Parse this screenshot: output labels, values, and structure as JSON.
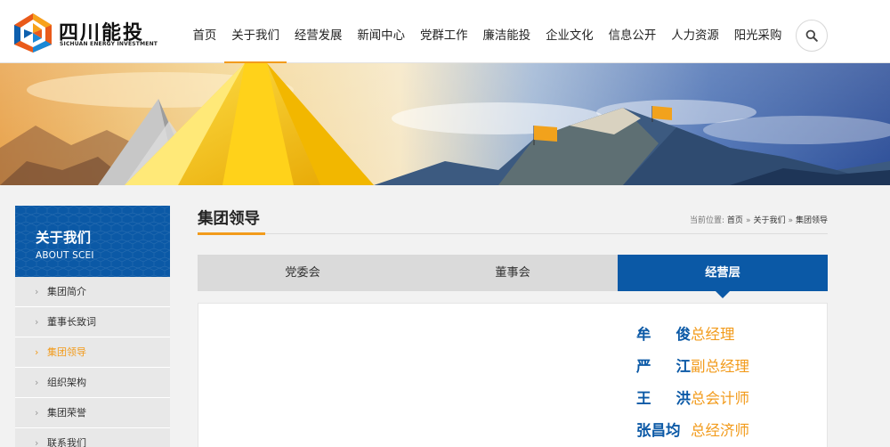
{
  "brand": {
    "name_cn": "四川能投",
    "name_en": "SICHUAN ENERGY INVESTMENT",
    "colors": {
      "blue": "#0b59a6",
      "orange": "#f29b1c"
    }
  },
  "nav": {
    "items": [
      {
        "label": "首页"
      },
      {
        "label": "关于我们",
        "active": true
      },
      {
        "label": "经营发展"
      },
      {
        "label": "新闻中心"
      },
      {
        "label": "党群工作"
      },
      {
        "label": "廉洁能投"
      },
      {
        "label": "企业文化"
      },
      {
        "label": "信息公开"
      },
      {
        "label": "人力资源"
      },
      {
        "label": "阳光采购"
      }
    ],
    "search_icon": "search-icon"
  },
  "sidebar": {
    "title": "关于我们",
    "subtitle": "ABOUT SCEI",
    "items": [
      {
        "label": "集团简介"
      },
      {
        "label": "董事长致词"
      },
      {
        "label": "集团领导",
        "active": true
      },
      {
        "label": "组织架构"
      },
      {
        "label": "集团荣誉"
      },
      {
        "label": "联系我们"
      }
    ]
  },
  "main": {
    "title": "集团领导",
    "breadcrumb": {
      "label": "当前位置:",
      "items": [
        "首页",
        "关于我们",
        "集团领导"
      ],
      "separator": "»"
    },
    "tabs": [
      {
        "label": "党委会"
      },
      {
        "label": "董事会"
      },
      {
        "label": "经营层",
        "active": true
      }
    ],
    "leaders": [
      {
        "name": [
          "牟",
          "俊"
        ],
        "title": "总经理"
      },
      {
        "name": [
          "严",
          "江"
        ],
        "title": "副总经理"
      },
      {
        "name": [
          "王",
          "洪"
        ],
        "title": "总会计师"
      },
      {
        "name": [
          "张昌均"
        ],
        "title": "总经济师"
      }
    ]
  }
}
